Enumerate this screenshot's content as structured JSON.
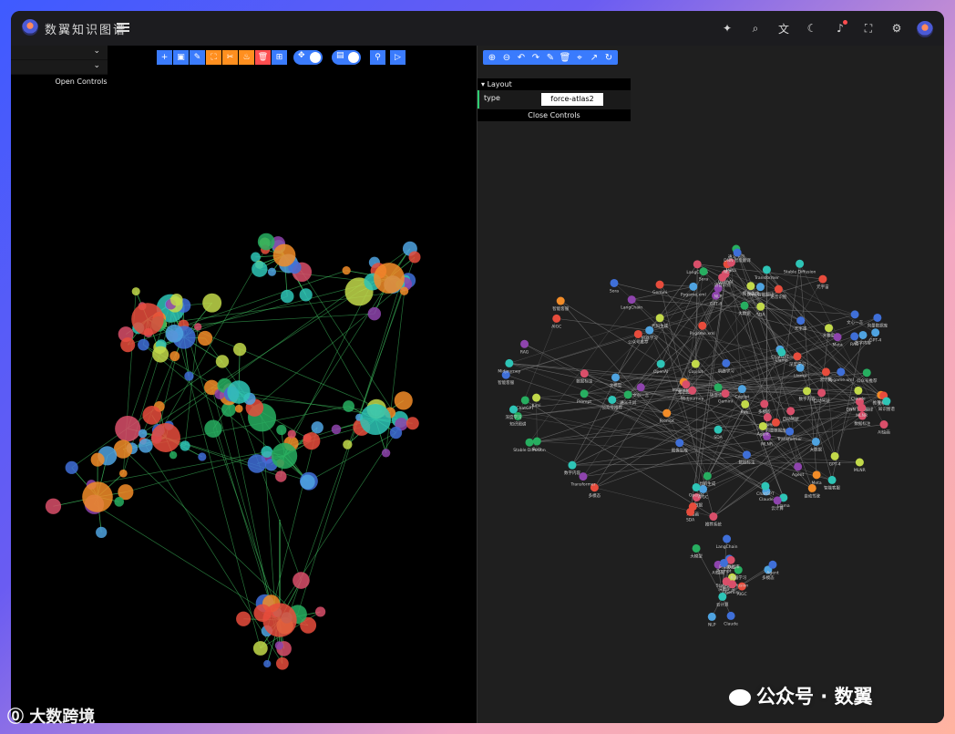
{
  "app": {
    "title": "数翼知识图谱"
  },
  "topbar_icons": [
    "sparkle-icon",
    "search-icon",
    "translate-icon",
    "moon-icon",
    "bell-icon",
    "fullscreen-icon",
    "gear-icon",
    "avatar"
  ],
  "left_panel": {
    "open_controls_label": "Open Controls",
    "toolbar": [
      "add",
      "folder",
      "edit",
      "select",
      "cut",
      "fire",
      "delete",
      "grid",
      "move-toggle",
      "save-toggle",
      "filter",
      "play"
    ]
  },
  "right_panel": {
    "toolbar": [
      "zoom-in",
      "zoom-out",
      "undo",
      "redo",
      "edit",
      "delete",
      "locate",
      "export",
      "refresh"
    ],
    "layout": {
      "section_label": "Layout",
      "type_label": "type",
      "type_value": "force-atlas2",
      "close_label": "Close Controls"
    }
  },
  "graph_labels": [
    "DNN 智能翻译",
    "大数据",
    "Pygame.xml",
    "元宇宙",
    "MLNR",
    "SDA",
    "公众号推荐",
    "Sora",
    "Meta",
    "数字内容",
    "ChatGPT",
    "GPT-4",
    "Transformer",
    "智能客服",
    "知识图谱",
    "语音识别",
    "OpenAI",
    "Llama",
    "自动驾驶",
    "Midjourney",
    "Copilot",
    "数据标注",
    "云计算",
    "大模型",
    "AIGC",
    "Stable Diffusion",
    "机器学习",
    "深度学习",
    "Gemini",
    "NLP",
    "多模态",
    "AI绘画",
    "向量数据库",
    "LangChain",
    "Agent",
    "RAG",
    "Prompt",
    "Claude",
    "文心一言",
    "通义千问",
    "Kimi",
    "推荐系统",
    "图像生成",
    "代码生成"
  ],
  "watermarks": {
    "left": "大数跨境",
    "right": "公众号 · 数翼"
  }
}
